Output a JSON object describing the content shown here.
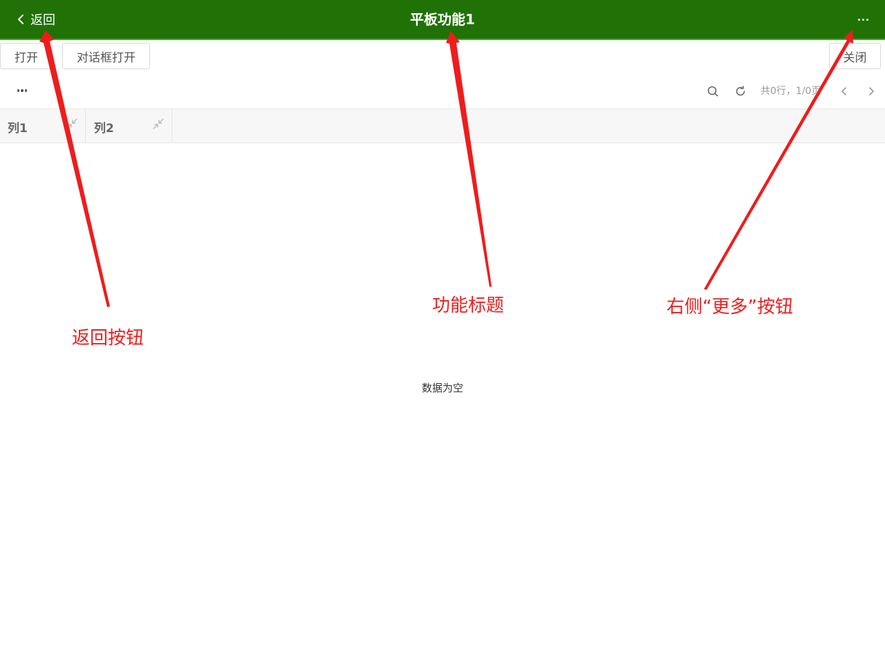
{
  "header": {
    "back_label": "返回",
    "title": "平板功能1",
    "background": "#207206",
    "icons": {
      "back": "chevron-left-icon",
      "more": "more-horizontal-icon"
    }
  },
  "toolbar": {
    "open_label": "打开",
    "dialog_open_label": "对话框打开",
    "close_label": "关闭"
  },
  "grid": {
    "more_icon": "more-horizontal-icon",
    "search_icon": "search-icon",
    "refresh_icon": "refresh-icon",
    "pager_text": "共0行，1/0页",
    "columns": [
      {
        "label": "列1",
        "icon": "collapse-icon"
      },
      {
        "label": "列2",
        "icon": "collapse-icon"
      }
    ],
    "empty_text": "数据为空"
  },
  "annotations": {
    "back_button": "返回按钮",
    "feature_title": "功能标题",
    "more_button": "右侧“更多”按钮",
    "color": "#ee1d1d"
  }
}
